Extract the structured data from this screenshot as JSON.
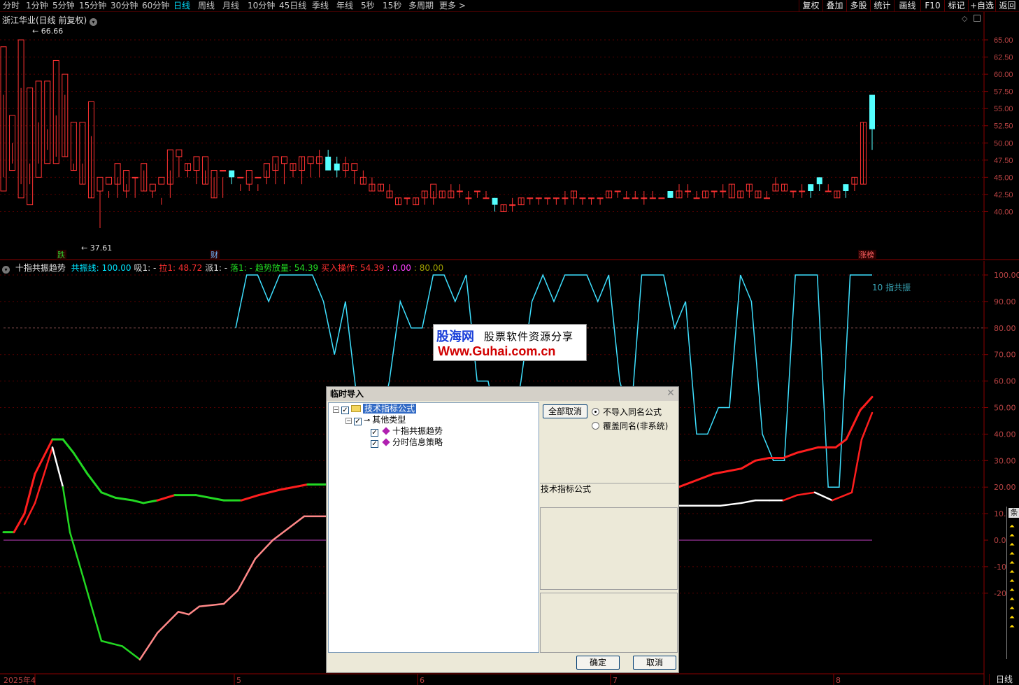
{
  "toolbar": {
    "timeframes": [
      "分时",
      "1分钟",
      "5分钟",
      "15分钟",
      "30分钟",
      "60分钟",
      "日线",
      "周线",
      "月线",
      "10分钟",
      "45日线",
      "季线",
      "年线",
      "5秒",
      "15秒",
      "多周期",
      "更多 >"
    ],
    "active": "日线",
    "right_buttons": [
      "复权",
      "叠加",
      "多股",
      "统计",
      "画线",
      "F10",
      "标记",
      "+自选",
      "返回"
    ]
  },
  "main_chart": {
    "title": "浙江华业(日线 前复权)",
    "price_axis": [
      "65.00",
      "62.50",
      "60.00",
      "57.50",
      "55.00",
      "52.50",
      "50.00",
      "47.50",
      "45.00",
      "42.50",
      "40.00"
    ],
    "high_label": "66.66",
    "low_label": "37.61",
    "markers": [
      {
        "text": "跌",
        "color": "#2ecc2e"
      },
      {
        "text": "财",
        "color": "#6fb6ff"
      },
      {
        "text": "涨榜",
        "color": "#ff6060"
      }
    ]
  },
  "indicator": {
    "name": "十指共振趋势",
    "items": [
      {
        "label": "共振线: 100.00",
        "color": "#00e5ff"
      },
      {
        "label": "吸1: -",
        "color": "#e0e0e0"
      },
      {
        "label": "拉1: 48.72",
        "color": "#ff3030"
      },
      {
        "label": "派1: -",
        "color": "#e0e0e0"
      },
      {
        "label": "落1: -",
        "color": "#22dd22"
      },
      {
        "label": "趋势放量: 54.39",
        "color": "#22dd22"
      },
      {
        "label": "买入操作: 54.39",
        "color": "#ff3030"
      },
      {
        "label": ": 0.00",
        "color": "#ff40ff"
      },
      {
        "label": ": 80.00",
        "color": "#a0a000"
      }
    ],
    "axis": [
      "100.00",
      "90.00",
      "80.00",
      "70.00",
      "60.00",
      "50.00",
      "40.00",
      "30.00",
      "20.00",
      "10.00",
      "0.00",
      "-10.00",
      "-20.00"
    ],
    "line_label": "10 指共振"
  },
  "date_axis": [
    "2025年4",
    "5",
    "6",
    "7",
    "8"
  ],
  "watermark": {
    "brand": "股海网",
    "slogan": "股票软件资源分享",
    "url": "Www.Guhai.com.cn"
  },
  "dialog": {
    "title": "临时导入",
    "tree": {
      "root": "技术指标公式",
      "child": "其他类型",
      "leaves": [
        "十指共振趋势",
        "分时信息策略"
      ]
    },
    "cancel_all": "全部取消",
    "options": [
      "不导入同名公式",
      "覆盖同名(非系统)"
    ],
    "selected_option": 0,
    "section_label": "技术指标公式",
    "ok": "确定",
    "cancel": "取消"
  },
  "bottom_tab": "日线",
  "side_panel_header": "条"
}
